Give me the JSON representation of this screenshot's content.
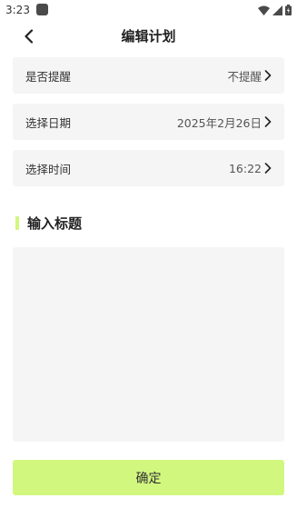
{
  "status_bar": {
    "time": "3:23",
    "icons": [
      "wifi-icon",
      "signal-icon",
      "battery-icon"
    ]
  },
  "header": {
    "back_icon": "chevron-left-icon",
    "title": "编辑计划"
  },
  "settings": {
    "reminder": {
      "label": "是否提醒",
      "value": "不提醒"
    },
    "date": {
      "label": "选择日期",
      "value": "2025年2月26日"
    },
    "time": {
      "label": "选择时间",
      "value": "16:22"
    }
  },
  "title_section": {
    "heading": "输入标题",
    "input_value": ""
  },
  "confirm_button": {
    "label": "确定"
  },
  "colors": {
    "accent": "#d2f77f",
    "row_background": "#f5f5f5",
    "text": "#222222"
  }
}
